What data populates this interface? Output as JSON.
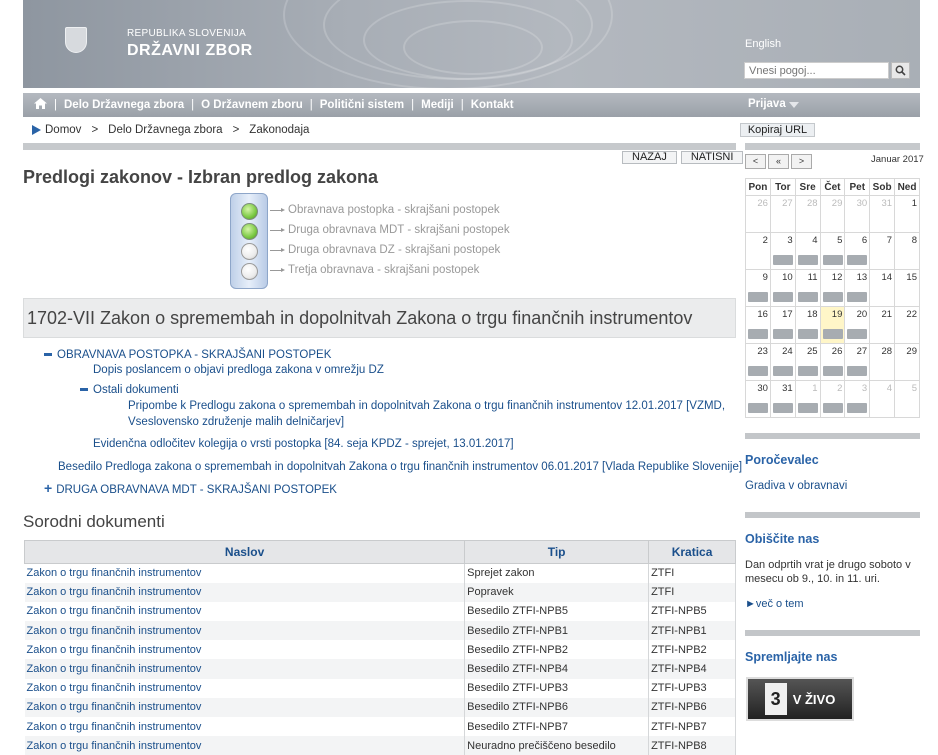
{
  "header": {
    "republic": "REPUBLIKA SLOVENIJA",
    "parliament": "DRŽAVNI ZBOR",
    "english_link": "English",
    "search_placeholder": "Vnesi pogoj..."
  },
  "nav": {
    "items": [
      "Delo Državnega zbora",
      "O Državnem zboru",
      "Politični sistem",
      "Mediji",
      "Kontakt"
    ],
    "login": "Prijava"
  },
  "breadcrumb": {
    "items": [
      "Domov",
      "Delo Državnega zbora",
      "Zakonodaja"
    ],
    "copy_url": "Kopiraj URL"
  },
  "buttons": {
    "back": "NAZAJ",
    "print": "NATISNI"
  },
  "page_title": "Predlogi zakonov - Izbran predlog zakona",
  "stages": [
    "Obravnava postopka - skrajšani postopek",
    "Druga obravnava MDT - skrajšani postopek",
    "Druga obravnava DZ - skrajšani postopek",
    "Tretja obravnava - skrajšani postopek"
  ],
  "law_title": "1702-VII Zakon o spremembah in dopolnitvah Zakona o trgu finančnih instrumentov",
  "tree": {
    "section1": "OBRAVNAVA POSTOPKA - SKRAJŠANI POSTOPEK",
    "doc1": "Dopis poslancem o objavi predloga zakona v omrežju DZ",
    "other_docs": "Ostali dokumenti",
    "remark_line1": "Pripombe k Predlogu zakona o spremembah in dopolnitvah Zakona o trgu finančnih instrumentov 12.01.2017 [VZMD,",
    "remark_line2": "Vseslovensko združenje malih delničarjev]",
    "record": "Evidenčna odločitev kolegija o vrsti postopka [84. seja KPDZ - sprejet, 13.01.2017]",
    "text": "Besedilo Predloga zakona o spremembah in dopolnitvah Zakona o trgu finančnih instrumentov 06.01.2017 [Vlada Republike Slovenije]",
    "section2": "DRUGA OBRAVNAVA MDT - SKRAJŠANI POSTOPEK"
  },
  "related": {
    "title": "Sorodni dokumenti",
    "columns": [
      "Naslov",
      "Tip",
      "Kratica"
    ],
    "rows": [
      [
        "Zakon o trgu finančnih instrumentov",
        "Sprejet zakon",
        "ZTFI"
      ],
      [
        "Zakon o trgu finančnih instrumentov",
        "Popravek",
        "ZTFI"
      ],
      [
        "Zakon o trgu finančnih instrumentov",
        "Besedilo ZTFI-NPB5",
        "ZTFI-NPB5"
      ],
      [
        "Zakon o trgu finančnih instrumentov",
        "Besedilo ZTFI-NPB1",
        "ZTFI-NPB1"
      ],
      [
        "Zakon o trgu finančnih instrumentov",
        "Besedilo ZTFI-NPB2",
        "ZTFI-NPB2"
      ],
      [
        "Zakon o trgu finančnih instrumentov",
        "Besedilo ZTFI-NPB4",
        "ZTFI-NPB4"
      ],
      [
        "Zakon o trgu finančnih instrumentov",
        "Besedilo ZTFI-UPB3",
        "ZTFI-UPB3"
      ],
      [
        "Zakon o trgu finančnih instrumentov",
        "Besedilo ZTFI-NPB6",
        "ZTFI-NPB6"
      ],
      [
        "Zakon o trgu finančnih instrumentov",
        "Besedilo ZTFI-NPB7",
        "ZTFI-NPB7"
      ],
      [
        "Zakon o trgu finančnih instrumentov",
        "Neuradno prečiščeno besedilo",
        "ZTFI-NPB8"
      ]
    ]
  },
  "calendar": {
    "nav": [
      "<",
      "«",
      ">"
    ],
    "month": "Januar 2017",
    "days": [
      "Pon",
      "Tor",
      "Sre",
      "Čet",
      "Pet",
      "Sob",
      "Ned"
    ],
    "weeks": [
      [
        {
          "d": "26",
          "o": true
        },
        {
          "d": "27",
          "o": true
        },
        {
          "d": "28",
          "o": true
        },
        {
          "d": "29",
          "o": true
        },
        {
          "d": "30",
          "o": true
        },
        {
          "d": "31",
          "o": true
        },
        {
          "d": "1"
        }
      ],
      [
        {
          "d": "2"
        },
        {
          "d": "3",
          "e": true
        },
        {
          "d": "4",
          "e": true
        },
        {
          "d": "5",
          "e": true
        },
        {
          "d": "6",
          "e": true
        },
        {
          "d": "7"
        },
        {
          "d": "8"
        }
      ],
      [
        {
          "d": "9",
          "e": true
        },
        {
          "d": "10",
          "e": true
        },
        {
          "d": "11",
          "e": true
        },
        {
          "d": "12",
          "e": true
        },
        {
          "d": "13",
          "e": true
        },
        {
          "d": "14"
        },
        {
          "d": "15"
        }
      ],
      [
        {
          "d": "16",
          "e": true
        },
        {
          "d": "17",
          "e": true
        },
        {
          "d": "18",
          "e": true
        },
        {
          "d": "19",
          "e": true,
          "t": true
        },
        {
          "d": "20",
          "e": true
        },
        {
          "d": "21"
        },
        {
          "d": "22"
        }
      ],
      [
        {
          "d": "23",
          "e": true
        },
        {
          "d": "24",
          "e": true
        },
        {
          "d": "25",
          "e": true
        },
        {
          "d": "26",
          "e": true
        },
        {
          "d": "27",
          "e": true
        },
        {
          "d": "28"
        },
        {
          "d": "29"
        }
      ],
      [
        {
          "d": "30",
          "e": true
        },
        {
          "d": "31",
          "e": true
        },
        {
          "d": "1",
          "o": true,
          "e": true
        },
        {
          "d": "2",
          "o": true,
          "e": true
        },
        {
          "d": "3",
          "o": true,
          "e": true
        },
        {
          "d": "4",
          "o": true
        },
        {
          "d": "5",
          "o": true
        }
      ]
    ]
  },
  "sidebar": {
    "reporter_title": "Poročevalec",
    "reporter_link": "Gradiva v obravnavi",
    "visit_title": "Obiščite nas",
    "visit_text_1": "Dan odprtih vrat je drugo soboto v",
    "visit_text_2": "mesecu ob 9., 10. in 11. uri.",
    "visit_more": "►več o tem",
    "follow_title": "Spremljajte nas",
    "live_channel": "3",
    "live_label": "V ŽIVO"
  },
  "colors": {
    "link": "#1a4f8b",
    "nav": "#9aa0a8",
    "light_green": "#7ac943"
  }
}
